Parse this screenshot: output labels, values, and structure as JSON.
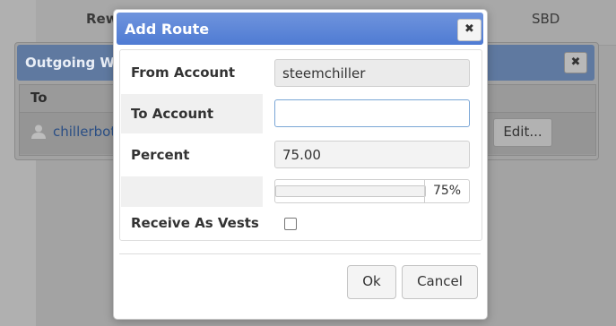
{
  "background": {
    "reward_label": "Reward",
    "reward_value": "SBD"
  },
  "outgoing_window": {
    "title": "Outgoing W",
    "close_glyph": "✖",
    "column_to": "To",
    "row": {
      "icon": "user-icon",
      "account": "chillerbot",
      "edit_label": "Edit..."
    }
  },
  "dialog": {
    "title": "Add Route",
    "close_glyph": "✖",
    "fields": {
      "from_account": {
        "label": "From Account",
        "value": "steemchiller"
      },
      "to_account": {
        "label": "To Account",
        "value": "",
        "placeholder": ""
      },
      "percent": {
        "label": "Percent",
        "value": "75.00"
      },
      "slider": {
        "value_label": "75%",
        "percent": 75
      },
      "receive_as_vests": {
        "label": "Receive As Vests",
        "checked": false
      }
    },
    "buttons": {
      "ok": "Ok",
      "cancel": "Cancel"
    }
  },
  "colors": {
    "title_bar": "#4f7bd3",
    "link": "#2b4f85",
    "overlay": "#9a9a9a"
  }
}
